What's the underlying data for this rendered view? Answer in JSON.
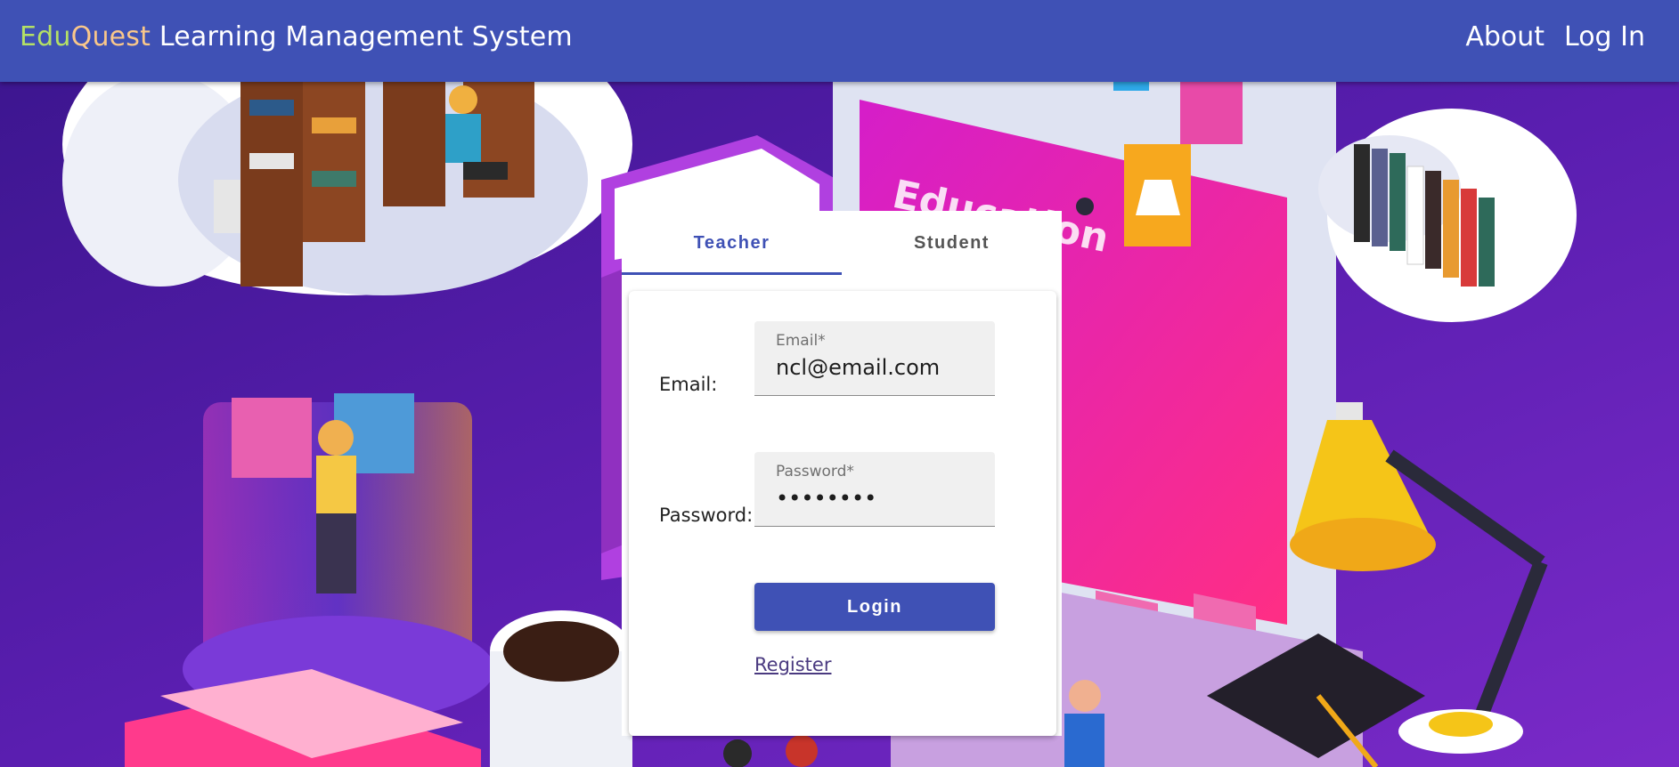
{
  "header": {
    "brand_part1": "Edu",
    "brand_part2": "Quest",
    "brand_rest": " Learning Management System",
    "nav": [
      {
        "label": "About"
      },
      {
        "label": "Log In"
      }
    ]
  },
  "login": {
    "tabs": [
      {
        "label": "Teacher",
        "active": true
      },
      {
        "label": "Student",
        "active": false
      }
    ],
    "email_row_label": "Email:",
    "email_field_label": "Email*",
    "email_value": "ncl@email.com",
    "password_row_label": "Password:",
    "password_field_label": "Password*",
    "password_value": "••••••••",
    "login_button": "Login",
    "register_link": "Register"
  },
  "illustration": {
    "laptop_screen_text": "Education"
  },
  "colors": {
    "primary": "#3f51b5",
    "brand_edu": "#b4e066",
    "brand_quest": "#f9c78a",
    "background_purple": "#4a1a9c",
    "laptop_screen_pink": "#e8289c"
  }
}
